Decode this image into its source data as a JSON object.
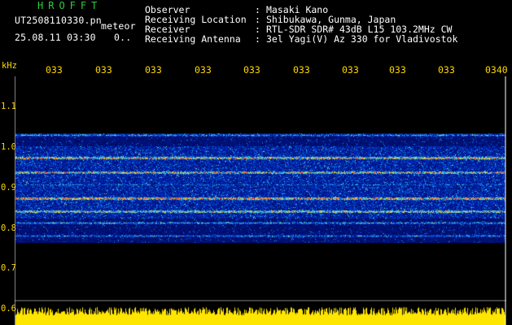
{
  "logo": "HROFFT",
  "file": {
    "name": "UT2508110330.pn",
    "timestamp": "25.08.11 03:30",
    "tag": "meteor",
    "count": "0.."
  },
  "header": {
    "rows": [
      {
        "label": "Observer",
        "value": "Masaki Kano"
      },
      {
        "label": "Receiving Location",
        "value": "Shibukawa, Gunma, Japan"
      },
      {
        "label": "Receiver",
        "value": "RTL-SDR SDR# 43dB L15 103.2MHz CW"
      },
      {
        "label": "Receiving Antenna",
        "value": "3el Yagi(V) Az 330 for Vladivostok"
      }
    ],
    "colon": ":"
  },
  "axis": {
    "y_unit": "kHz",
    "y_ticks": [
      "1.1",
      "1.0",
      "0.9",
      "0.8",
      "0.7",
      "0.6"
    ],
    "x_ticks": [
      "033",
      "033",
      "033",
      "033",
      "033",
      "033",
      "033",
      "033",
      "033",
      "0340"
    ]
  },
  "colors": {
    "axis_text": "#ffd800",
    "logo": "#2ecc40",
    "noise_bar": "#ffe600",
    "spectrum_low": "#0a1a8c",
    "spectrum_high": "#ff3b1f"
  }
}
